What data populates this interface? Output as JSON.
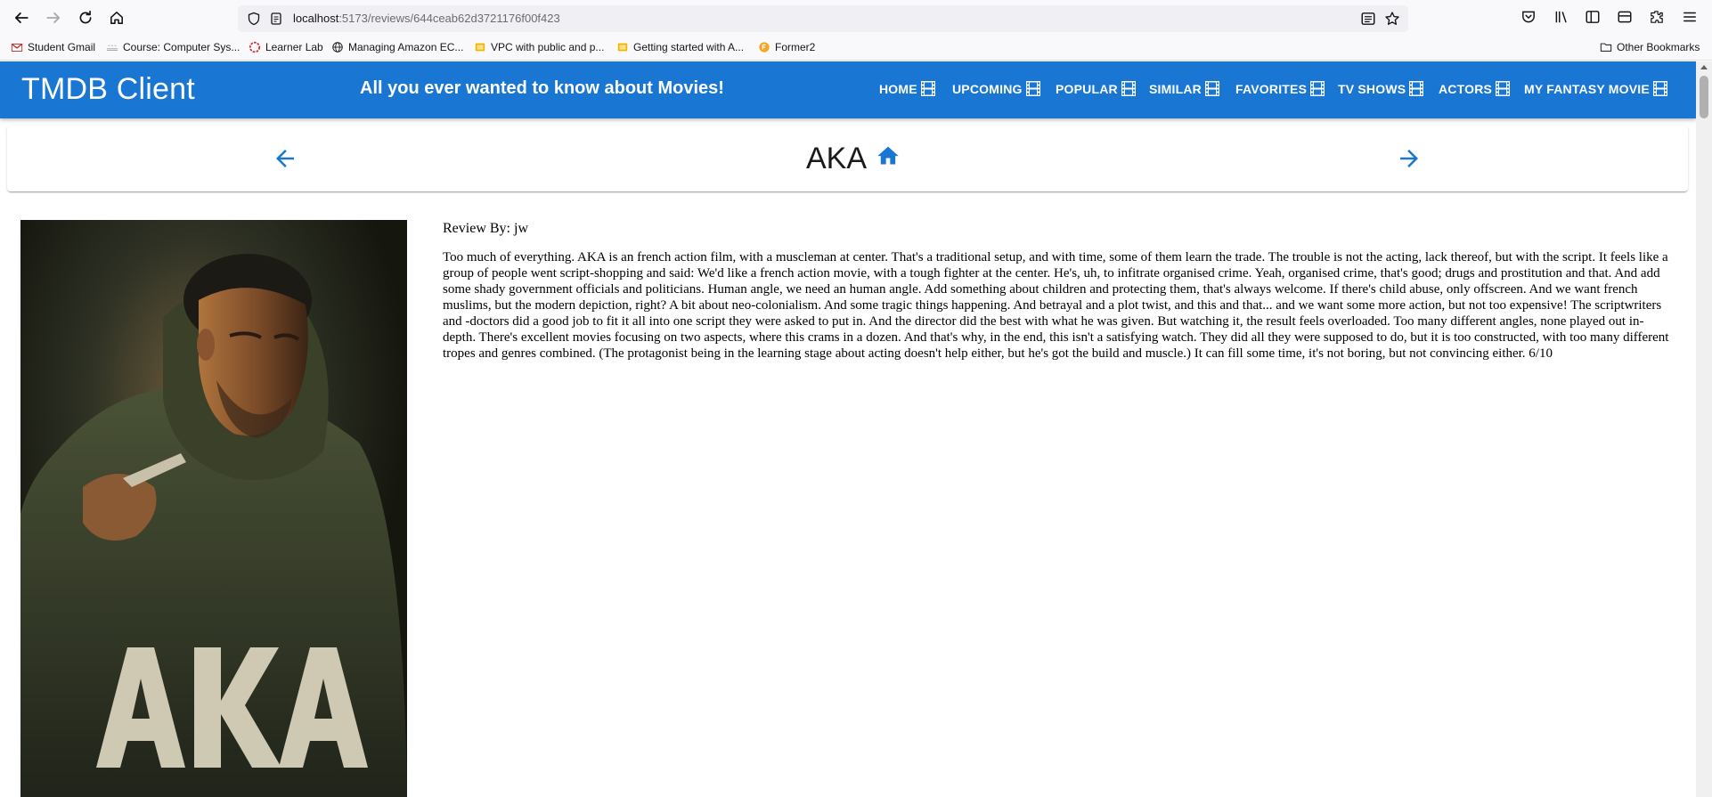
{
  "browser": {
    "url_host": "localhost",
    "url_path": ":5173/reviews/644ceab62d3721176f00f423",
    "bookmarks": [
      {
        "label": "Student Gmail",
        "icon": "gmail-icon"
      },
      {
        "label": "Course: Computer Sys...",
        "icon": "course-icon"
      },
      {
        "label": "Learner Lab",
        "icon": "learner-lab-icon"
      },
      {
        "label": "Managing Amazon EC...",
        "icon": "globe-icon"
      },
      {
        "label": "VPC with public and p...",
        "icon": "aws-docs-icon"
      },
      {
        "label": "Getting started with A...",
        "icon": "aws-docs-icon"
      },
      {
        "label": "Former2",
        "icon": "former2-icon"
      }
    ],
    "other_bookmarks": "Other Bookmarks"
  },
  "header": {
    "title": "TMDB Client",
    "tagline": "All you ever wanted to know about Movies!",
    "nav": [
      "HOME",
      "UPCOMING",
      "POPULAR",
      "SIMILAR",
      "FAVORITES",
      "TV SHOWS",
      "ACTORS",
      "MY FANTASY MOVIE"
    ]
  },
  "movie": {
    "title": "AKA",
    "poster_text": "AKA"
  },
  "review": {
    "author_line": "Review By: jw",
    "content": "Too much of everything.  AKA is an french action film, with a muscleman at center. That's a traditional setup, and with time, some of them learn the trade.  The trouble is not the acting, lack thereof, but with the script.  It feels like a group of people went script-shopping and said: We'd like a french action movie, with a tough fighter at the center. He's, uh, to infitrate organised crime. Yeah, organised crime, that's good; drugs and prostitution and that. And add some shady government officials and politicians. Human angle, we need an human angle. Add something about children and protecting them, that's always welcome. If there's child abuse, only offscreen. And we want french muslims, but the modern depiction, right? A bit about neo-colonialism. And some tragic things happening. And betrayal and a plot twist, and this and that... and we want some more action, but not too expensive!  The scriptwriters and -doctors did a good job to fit it all into one script they were asked to put in. And the director did the best with what he was given. But watching it, the result feels overloaded. Too many different angles, none played out in-depth. There's excellent movies focusing on two aspects, where this crams in a dozen.  And that's why, in the end, this isn't a satisfying watch. They did all they were supposed to do, but it is too constructed, with too many different tropes and genres combined. (The protagonist being in the learning stage about acting doesn't help either, but he's got the build and muscle.)  It can fill some time, it's not boring, but not convincing either. 6/10"
  },
  "colors": {
    "primary": "#1976d2",
    "text": "#000000"
  }
}
